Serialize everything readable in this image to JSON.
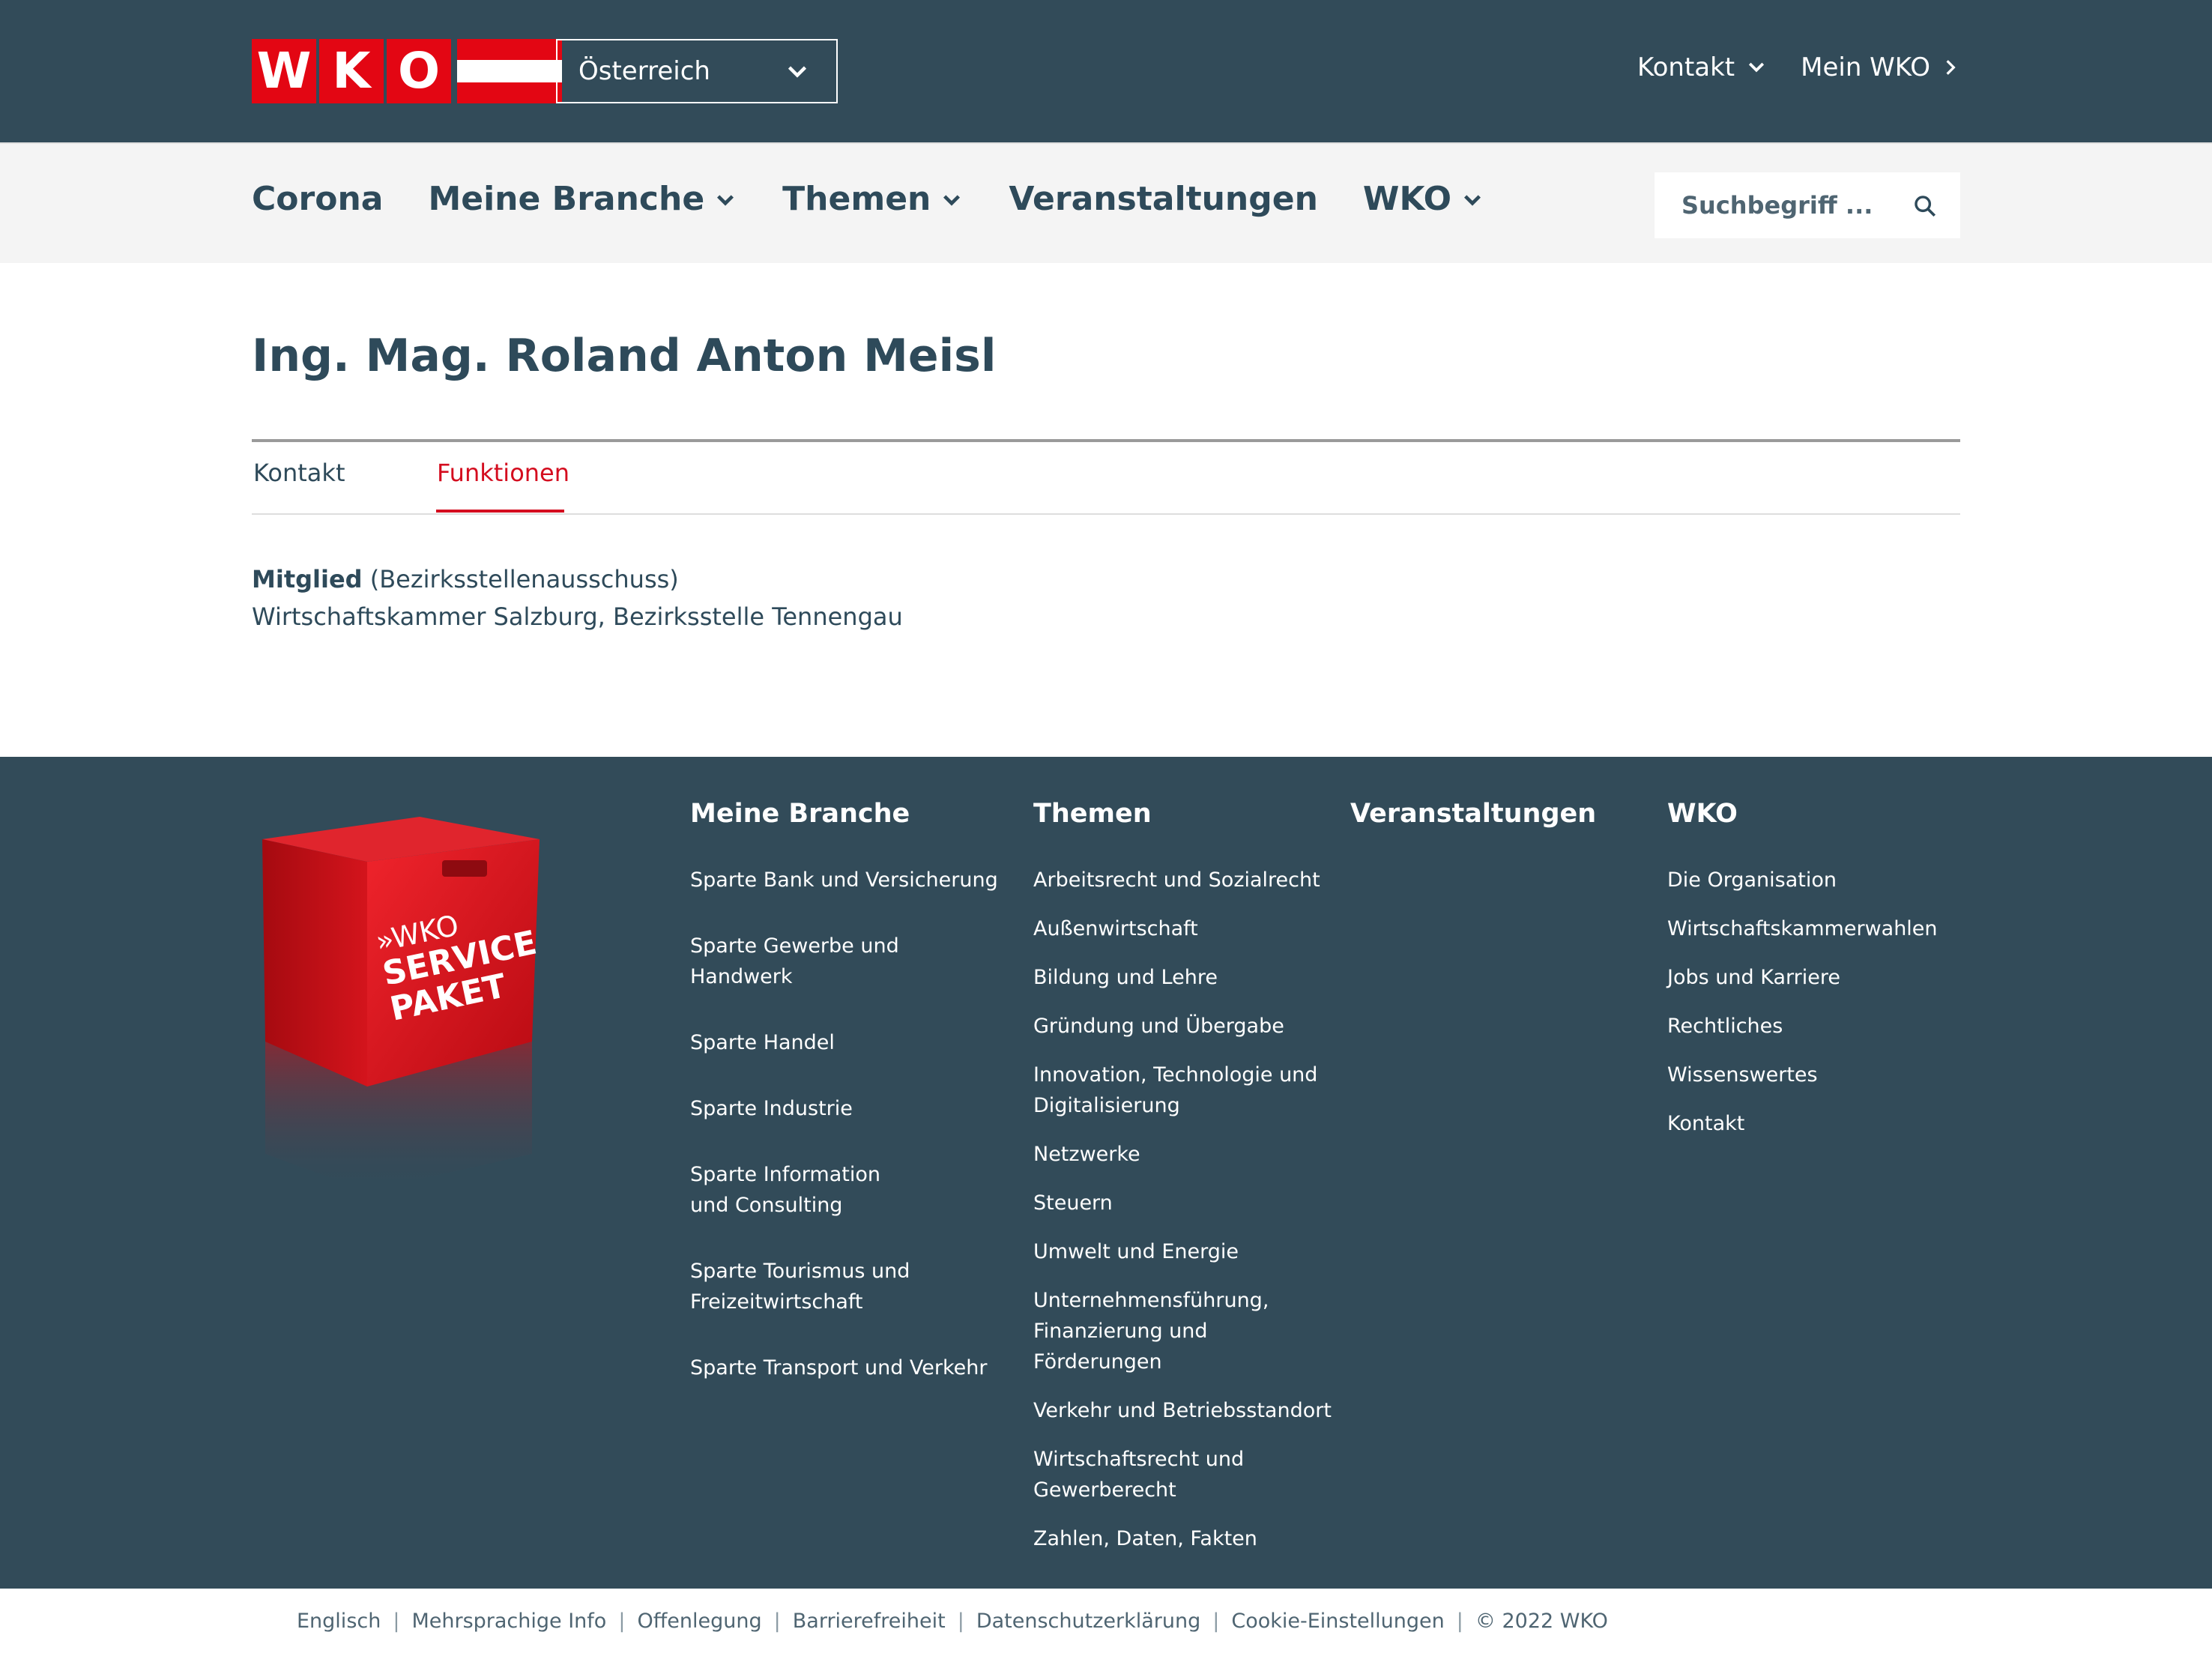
{
  "header": {
    "logo_letters": [
      "W",
      "K",
      "O"
    ],
    "region": "Österreich",
    "links": [
      {
        "label": "Kontakt",
        "icon": "chevron-down-icon"
      },
      {
        "label": "Mein WKO",
        "icon": "chevron-right-icon"
      }
    ]
  },
  "nav": {
    "items": [
      {
        "label": "Corona",
        "dropdown": false
      },
      {
        "label": "Meine Branche",
        "dropdown": true
      },
      {
        "label": "Themen",
        "dropdown": true
      },
      {
        "label": "Veranstaltungen",
        "dropdown": false
      },
      {
        "label": "WKO",
        "dropdown": true
      }
    ],
    "search_placeholder": "Suchbegriff ..."
  },
  "person": {
    "name": "Ing. Mag. Roland Anton Meisl",
    "tabs": [
      {
        "label": "Kontakt",
        "active": false
      },
      {
        "label": "Funktionen",
        "active": true
      }
    ],
    "function": {
      "role": "Mitglied",
      "body": "(Bezirksstellenausschuss)",
      "organisation": "Wirtschaftskammer Salzburg, Bezirksstelle Tennengau"
    }
  },
  "footer": {
    "promo_image": {
      "text_line1": "»WKO",
      "text_line2": "SERVICE",
      "text_line3": "PAKET",
      "color": "#e30613"
    },
    "columns": [
      {
        "title": "Meine Branche",
        "items": [
          "Sparte Bank und Versicherung",
          "Sparte Gewerbe und Handwerk",
          "Sparte Handel",
          "Sparte Industrie",
          "Sparte Information und Consulting",
          "Sparte Tourismus und Freizeitwirtschaft",
          "Sparte Transport und Verkehr"
        ]
      },
      {
        "title": "Themen",
        "items": [
          "Arbeitsrecht und Sozialrecht",
          "Außenwirtschaft",
          "Bildung und Lehre",
          "Gründung und Übergabe",
          "Innovation, Technologie und Digitalisierung",
          "Netzwerke",
          "Steuern",
          "Umwelt und Energie",
          "Unternehmensführung, Finanzierung und Förderungen",
          "Verkehr und Betriebsstandort",
          "Wirtschaftsrecht und Gewerberecht",
          "Zahlen, Daten, Fakten"
        ]
      },
      {
        "title": "Veranstaltungen",
        "items": []
      },
      {
        "title": "WKO",
        "items": [
          "Die Organisation",
          "Wirtschaftskammerwahlen",
          "Jobs und Karriere",
          "Rechtliches",
          "Wissenswertes",
          "Kontakt"
        ]
      }
    ],
    "legal": [
      "Englisch",
      "Mehrsprachige Info",
      "Offenlegung",
      "Barrierefreiheit",
      "Datenschutzerklärung",
      "Cookie-Einstellungen",
      "© 2022 WKO"
    ]
  },
  "colors": {
    "header_bg": "#324b59",
    "nav_bg": "#f4f4f4",
    "accent_red": "#d40d1f",
    "text": "#2e4a5a"
  }
}
